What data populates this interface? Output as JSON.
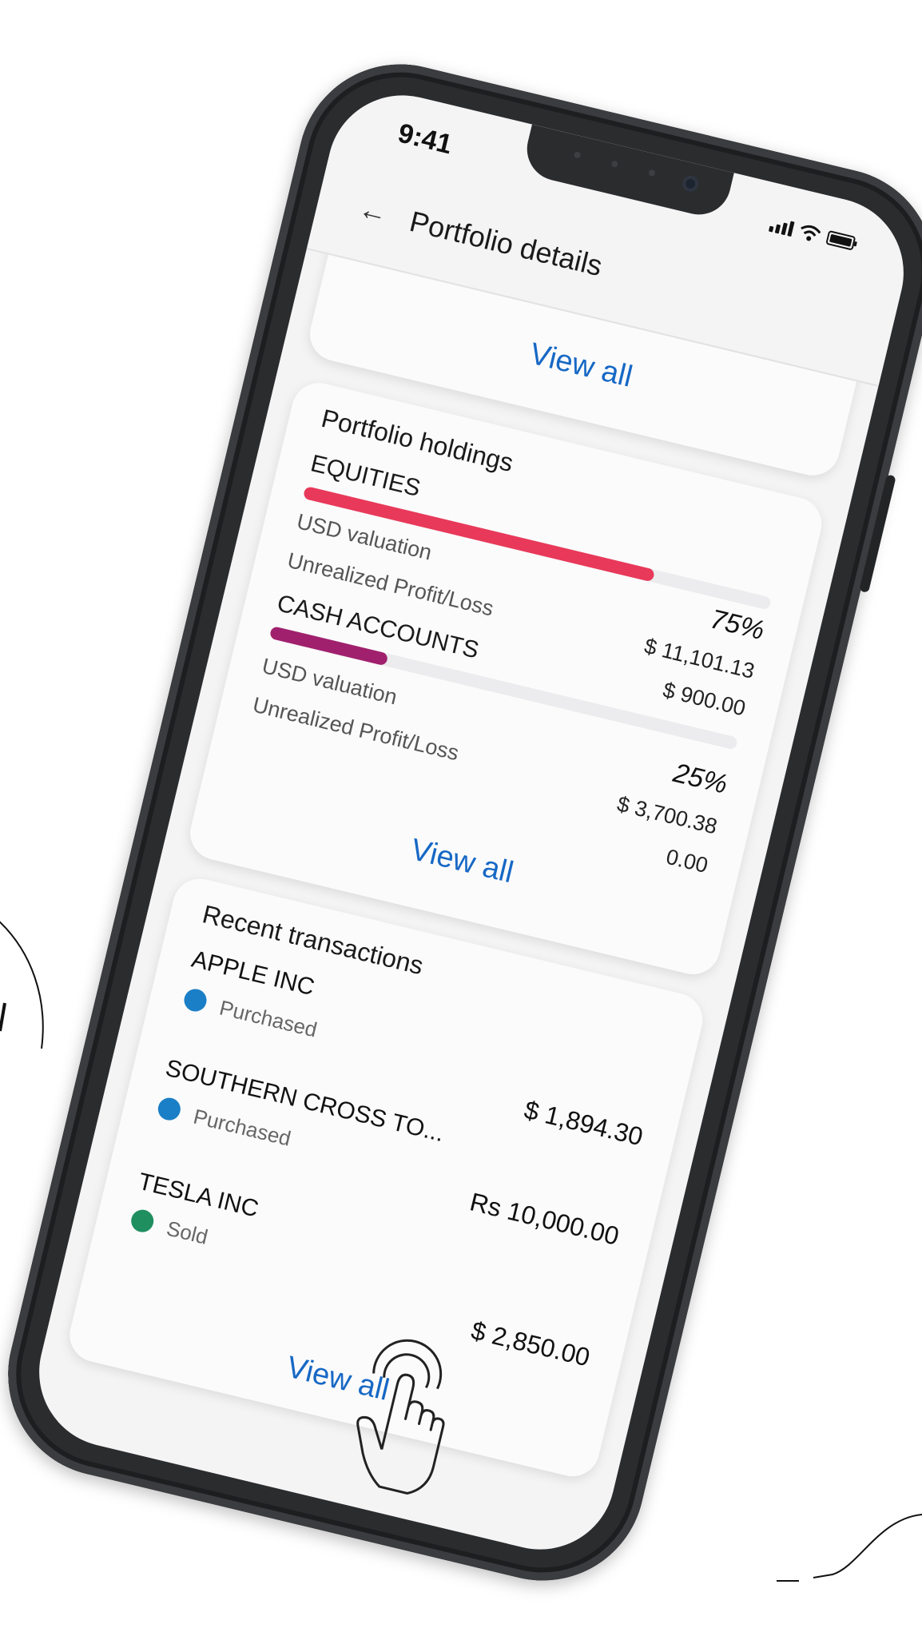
{
  "status_bar": {
    "time": "9:41"
  },
  "header": {
    "back_icon": "back-arrow-icon",
    "title": "Portfolio details"
  },
  "top_card": {
    "view_all": "View all"
  },
  "holdings": {
    "title": "Portfolio holdings",
    "items": [
      {
        "name": "EQUITIES",
        "percent": "75%",
        "fraction": 0.75,
        "color": "#e8395a",
        "usd_label": "USD valuation",
        "usd_value": "$ 11,101.13",
        "pl_label": "Unrealized Profit/Loss",
        "pl_value": "$ 900.00"
      },
      {
        "name": "CASH ACCOUNTS",
        "percent": "25%",
        "fraction": 0.25,
        "color": "#a0206e",
        "usd_label": "USD valuation",
        "usd_value": "$ 3,700.38",
        "pl_label": "Unrealized Profit/Loss",
        "pl_value": "0.00"
      }
    ],
    "view_all": "View all"
  },
  "transactions": {
    "title": "Recent transactions",
    "items": [
      {
        "name": "APPLE INC",
        "status": "Purchased",
        "status_color": "#1a7fc6",
        "amount": "$ 1,894.30"
      },
      {
        "name": "SOUTHERN CROSS TO...",
        "status": "Purchased",
        "status_color": "#1a7fc6",
        "amount": "Rs 10,000.00"
      },
      {
        "name": "TESLA INC",
        "status": "Sold",
        "status_color": "#1f8f5f",
        "amount": "$ 2,850.00"
      }
    ],
    "view_all": "View all"
  },
  "icons": {
    "signal": "signal-icon",
    "wifi": "wifi-icon",
    "battery": "battery-icon",
    "tap_hand": "tap-hand-icon"
  }
}
